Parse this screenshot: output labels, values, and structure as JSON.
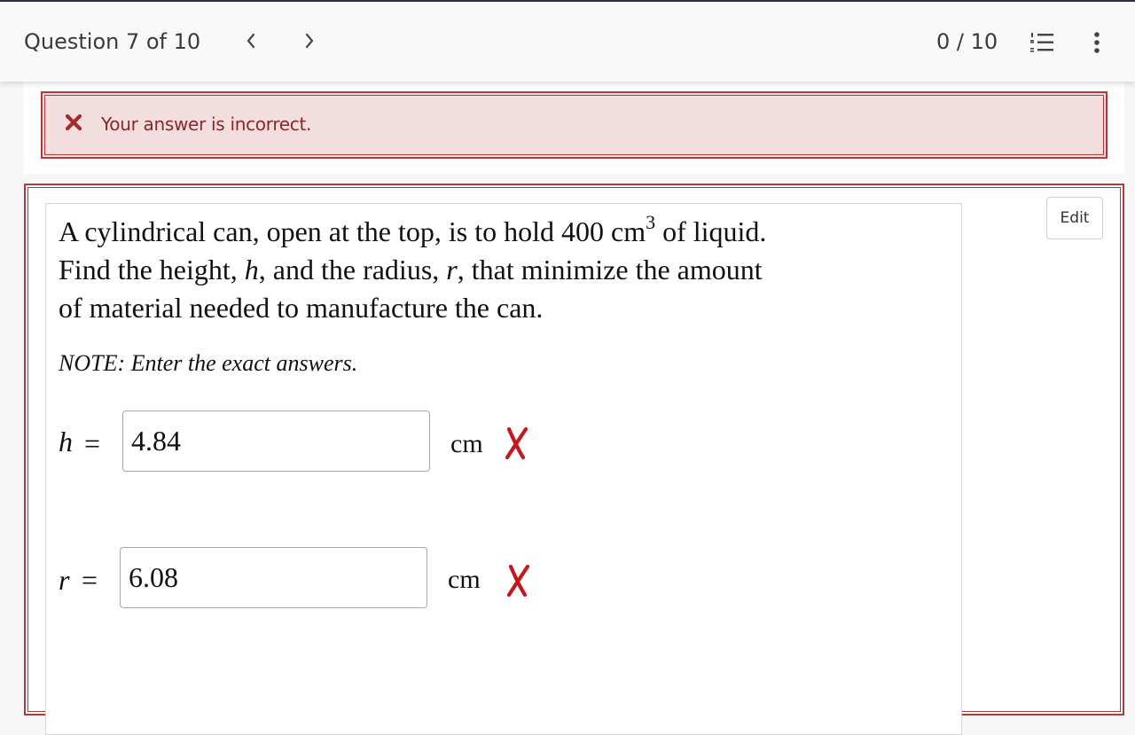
{
  "header": {
    "question_label": "Question 7 of 10",
    "score": "0 / 10"
  },
  "feedback": {
    "message": "Your answer is incorrect.",
    "color": "#b23a3a"
  },
  "edit_label": "Edit",
  "question": {
    "line1_before": "A cylindrical can, open at the top, is to hold 400 cm",
    "line1_sup": "3",
    "line1_after": " of liquid.",
    "line2_a": "Find the height, ",
    "line2_h": "h",
    "line2_b": ", and the radius, ",
    "line2_r": "r",
    "line2_c": ", that minimize the amount",
    "line3": "of material needed to manufacture the can.",
    "note": "NOTE: Enter the exact answers."
  },
  "answers": [
    {
      "variable": "h",
      "equals": "=",
      "value": "4.84",
      "unit": "cm",
      "status": "incorrect"
    },
    {
      "variable": "r",
      "equals": "=",
      "value": "6.08",
      "unit": "cm",
      "status": "incorrect"
    }
  ],
  "icons": {
    "prev": "chevron-left-icon",
    "next": "chevron-right-icon",
    "list": "numbered-list-icon",
    "more": "more-vertical-icon",
    "error": "close-icon",
    "wrong_mark": "cross-mark-icon"
  }
}
